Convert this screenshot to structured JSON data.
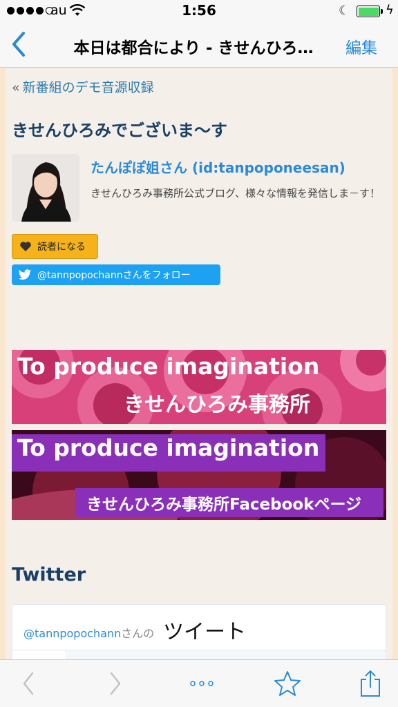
{
  "status": {
    "carrier": "au",
    "time": "1:56"
  },
  "nav": {
    "title": "本日は都合により - きせんひろ…",
    "edit_label": "編集"
  },
  "article": {
    "prev_link_label": "新番組のデモ音源収録",
    "heading": "きせんひろみでございま〜す"
  },
  "author": {
    "name": "たんぽぽ姐さん (id:tanpoponeesan)",
    "description": "きせんひろみ事務所公式ブログ、様々な情報を発信しま－す！",
    "subscribe_label": "読者になる",
    "twitter_follow_label": "@tannpopochannさんをフォロー"
  },
  "banners": [
    {
      "line1": "To produce imagination",
      "line2": "きせんひろみ事務所"
    },
    {
      "line1": "To produce imagination",
      "line2": "きせんひろみ事務所Facebookページ"
    }
  ],
  "twitter": {
    "heading": "Twitter",
    "user": "@tannpopochann",
    "user_suffix": "さんの",
    "label": "ツイート"
  },
  "colors": {
    "accent": "#2a8ad8",
    "heading": "#1a3f66",
    "twitter": "#1da1f2",
    "subscribe": "#f5b21b",
    "page_bg": "#f4f0e9"
  },
  "icons": [
    "back-chevron-icon",
    "wifi-icon",
    "moon-icon",
    "battery-icon",
    "heart-icon",
    "twitter-bird-icon",
    "browser-back-icon",
    "browser-forward-icon",
    "more-icon",
    "bookmark-star-icon",
    "share-icon"
  ]
}
